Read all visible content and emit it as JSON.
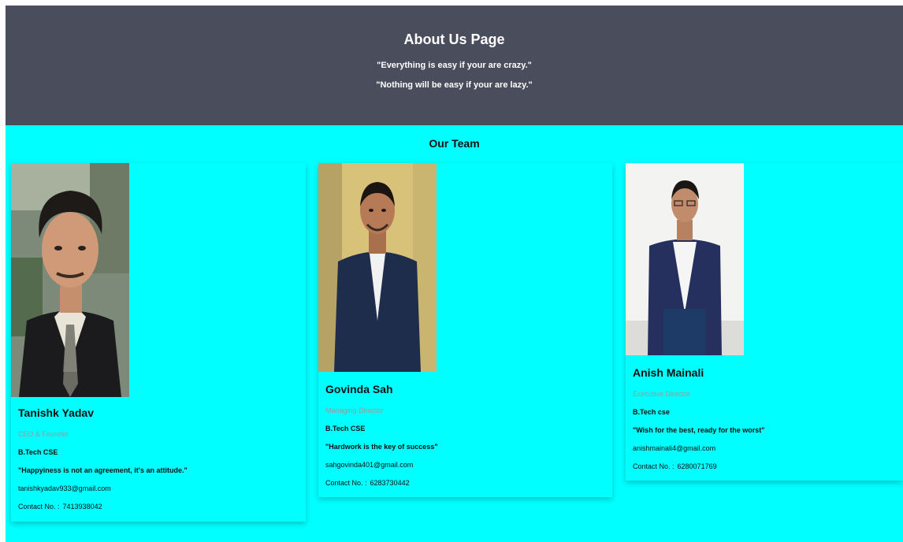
{
  "hero": {
    "title": "About Us Page",
    "quote_1": "\"Everything is easy if your are crazy.\"",
    "quote_2": "\"Nothing will be easy if your are lazy.\""
  },
  "team": {
    "title": "Our Team",
    "members": [
      {
        "name": "Tanishk Yadav",
        "role": "CEO & Founder",
        "degree": "B.Tech CSE",
        "quote": "\"Happyiness is not an agreement, it's an attitude.\"",
        "email": "tanishkyadav933@gmail.com",
        "contact_label": "Contact No. :",
        "contact_number": "7413938042"
      },
      {
        "name": "Govinda Sah",
        "role": "Managing Director",
        "degree": "B.Tech CSE",
        "quote": "\"Hardwork is the key of success\"",
        "email": "sahgovinda401@gmail.com",
        "contact_label": "Contact No. :",
        "contact_number": "6283730442"
      },
      {
        "name": "Anish Mainali",
        "role": "Executive Director",
        "degree": "B.Tech cse",
        "quote": "\"Wish for the best, ready for the worst\"",
        "email": "anishmainali4@gmail.com",
        "contact_label": "Contact No. :",
        "contact_number": "6280071769"
      }
    ]
  },
  "colors": {
    "hero_background": "#4a4d5c",
    "team_background": "#00ffff",
    "role_text": "#9a9a9a"
  }
}
